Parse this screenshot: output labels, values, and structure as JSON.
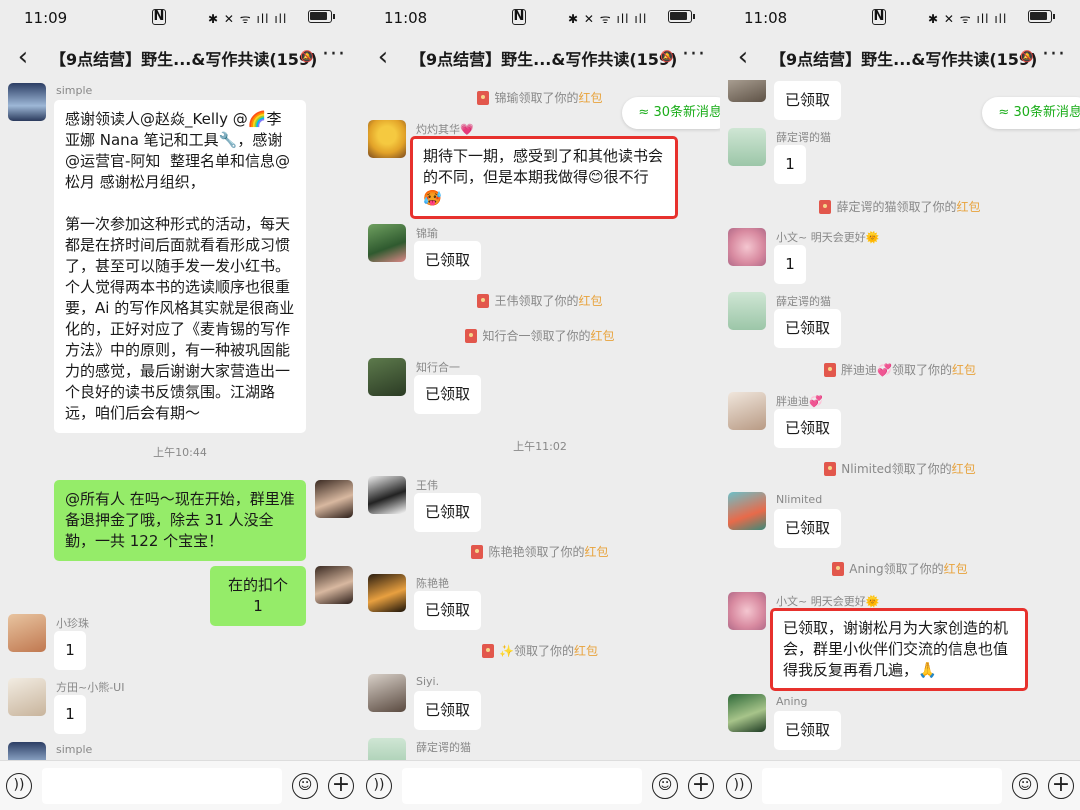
{
  "status": {
    "time": "11:09",
    "time2": "11:08",
    "time3": "11:08",
    "nfc": "N",
    "icons": "✱ ✕ ᯤ ıll ıll"
  },
  "chat": {
    "title": "【9点结营】野生...&写作共读(159)",
    "mute_icon": "bell-off",
    "more": "···",
    "new_msgs": "≈ 30条新消息"
  },
  "panel1": {
    "msg1_name": "simple",
    "msg1_text": "感谢领读人@赵焱_Kelly @🌈李亚娜 Nana 笔记和工具🔧，感谢@运营官-阿知  整理名单和信息@松月 感谢松月组织，\n\n第一次参加这种形式的活动，每天都是在挤时间后面就看看形成习惯了，甚至可以随手发一发小红书。个人觉得两本书的选读顺序也很重要，Ai 的写作风格其实就是很商业化的，正好对应了《麦肯锡的写作方法》中的原则，有一种被巩固能力的感觉，最后谢谢大家营造出一个良好的读书反馈氛围。江湖路远，咱们后会有期～",
    "time1": "上午10:44",
    "msg2_text": "@所有人  在吗～现在开始，群里准备退押金了哦，除去 31 人没全勤，一共 122 个宝宝！",
    "msg3_text": "在的扣个 1",
    "msg4_name": "小珍珠",
    "msg4_text": "1",
    "msg5_name": "方田~小熊-UI",
    "msg5_text": "1",
    "msg6_name": "simple"
  },
  "panel2": {
    "sys1": "锦瑜领取了你的",
    "msg1_name": "灼灼其华💗",
    "msg1_text": "期待下一期，感受到了和其他读书会的不同，但是本期我做得😊很不行🥵",
    "msg2_name": "锦瑜",
    "msg2_text": "已领取",
    "sys2": "王伟领取了你的",
    "sys3": "知行合一领取了你的",
    "msg3_name": "知行合一",
    "msg3_text": "已领取",
    "time1": "上午11:02",
    "msg4_name": "王伟",
    "msg4_text": "已领取",
    "sys4": "陈艳艳领取了你的",
    "msg5_name": "陈艳艳",
    "msg5_text": "已领取",
    "sys5": "✨领取了你的",
    "msg6_name": "Siyi.",
    "msg6_text": "已领取",
    "msg7_name": "薛定谔的猫"
  },
  "panel3": {
    "msg1_text": "已领取",
    "msg2_name": "薛定谔的猫",
    "msg2_text": "1",
    "sys1": "薛定谔的猫领取了你的",
    "msg3_name": "小文~ 明天会更好🌞",
    "msg3_text": "1",
    "msg4_name": "薛定谔的猫",
    "msg4_text": "已领取",
    "sys2": "胖迪迪💞领取了你的",
    "msg5_name": "胖迪迪💞",
    "msg5_text": "已领取",
    "sys3": "Nlimited领取了你的",
    "msg6_name": "Nlimited",
    "msg6_text": "已领取",
    "sys4": "Aning领取了你的",
    "msg7_name": "小文~ 明天会更好🌞",
    "msg7_text": "已领取，谢谢松月为大家创造的机会，群里小伙伴们交流的信息也值得我反复再看几遍，🙏",
    "msg8_name": "Aning",
    "msg8_text": "已领取"
  },
  "redpacket": "红包",
  "input": {
    "voice": "))",
    "emoji": "☺",
    "plus": "+"
  },
  "colors": {
    "green_bubble": "#95ec69",
    "highlight_border": "#e7312d",
    "redpacket_label": "#e8a33d",
    "new_msgs_text": "#1aad19"
  }
}
